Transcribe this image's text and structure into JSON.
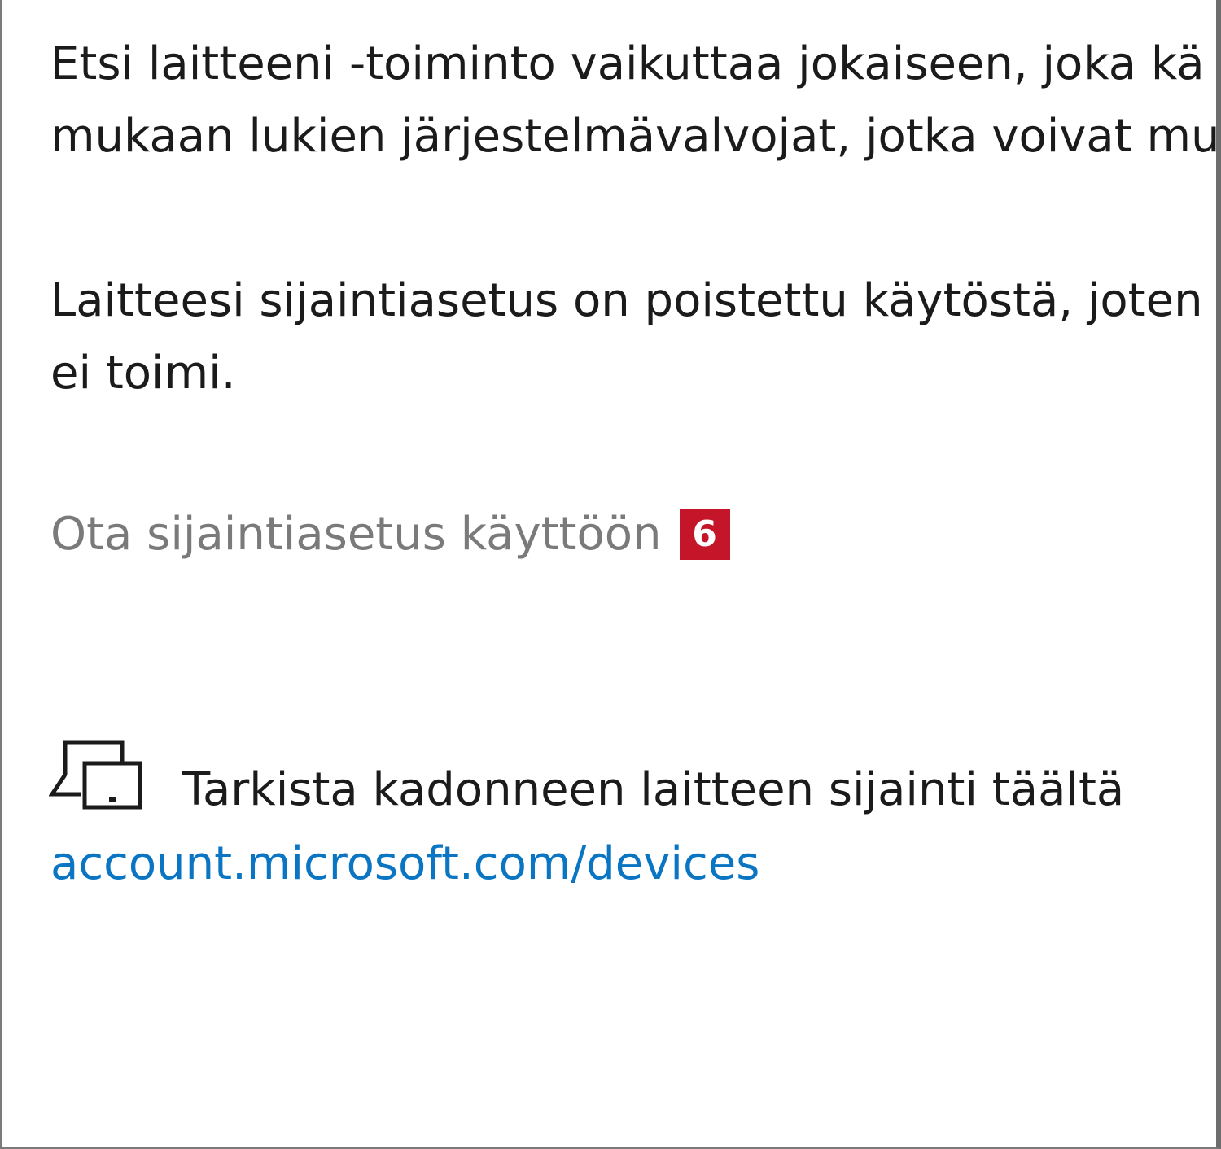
{
  "description": {
    "line1": "Etsi laitteeni -toiminto vaikuttaa jokaiseen, joka kä",
    "line2": "mukaan lukien järjestelmävalvojat, jotka voivat mu"
  },
  "location_status": {
    "line1": "Laitteesi sijaintiasetus on poistettu käytöstä, joten",
    "line2": "ei toimi."
  },
  "enable_location": {
    "label": "Ota sijaintiasetus käyttöön",
    "badge": "6",
    "badge_color": "#c41628"
  },
  "lost_device": {
    "icon": "devices-icon",
    "label": "Tarkista kadonneen laitteen sijainti täältä",
    "link": "account.microsoft.com/devices",
    "link_color": "#0a75c2"
  }
}
